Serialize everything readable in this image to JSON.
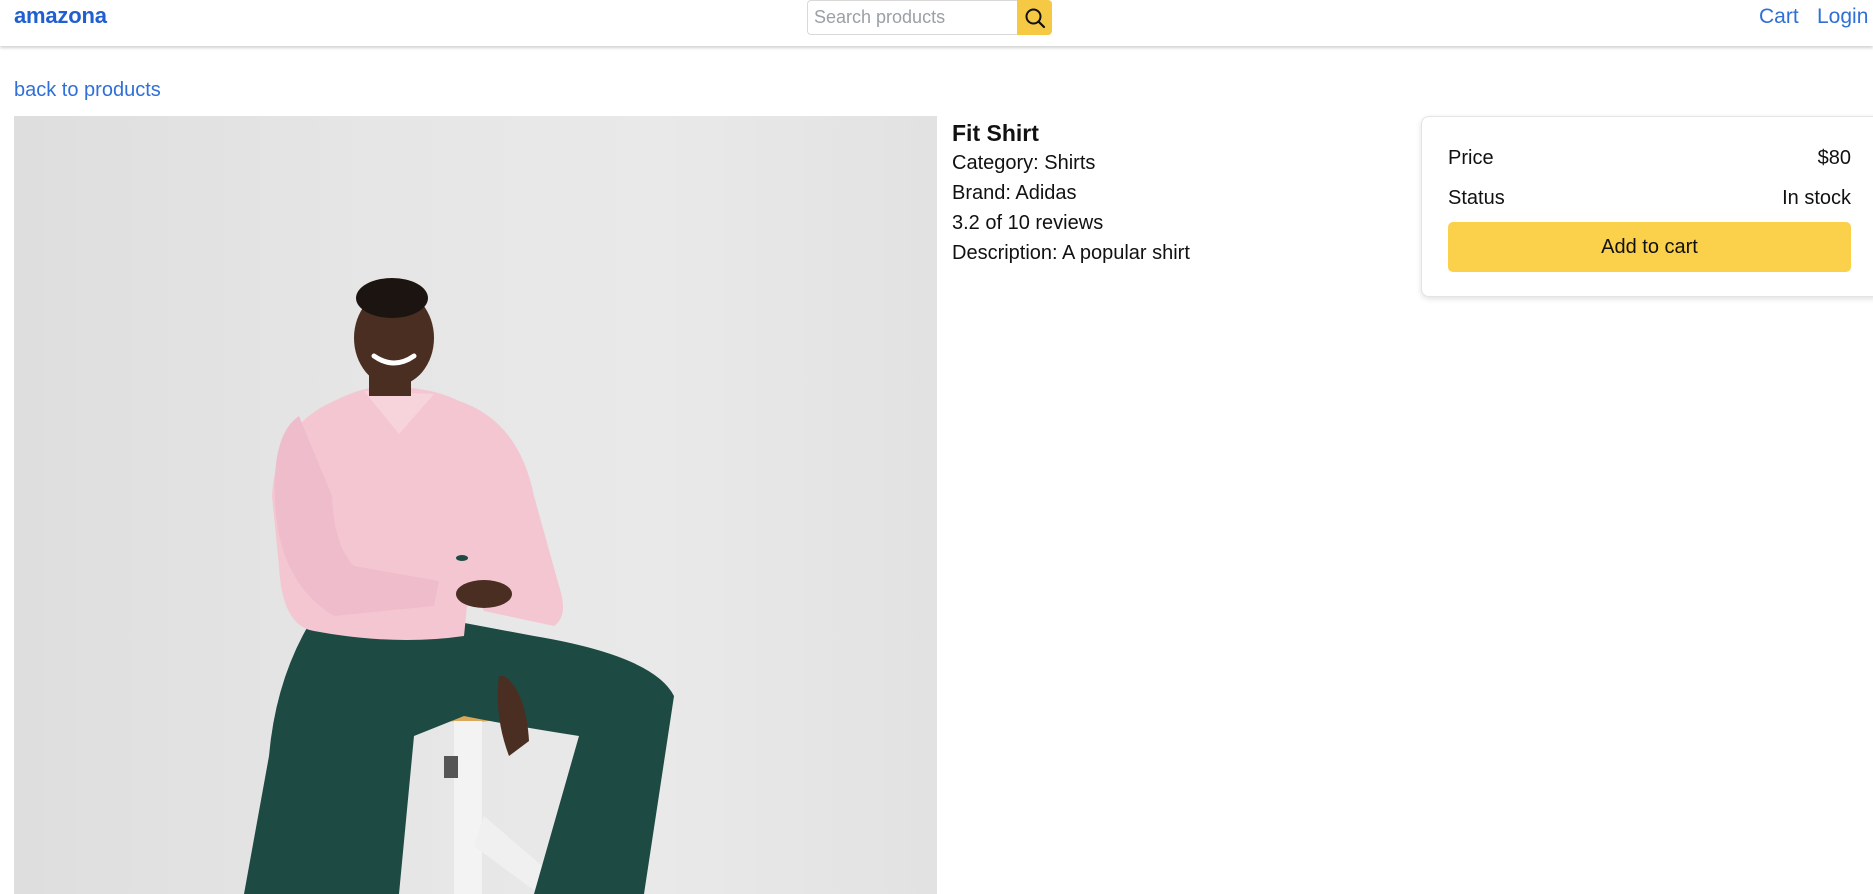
{
  "header": {
    "brand": "amazona",
    "search": {
      "placeholder": "Search products",
      "value": "",
      "button_icon": "search-icon"
    },
    "nav": {
      "cart": "Cart",
      "login": "Login"
    },
    "colors": {
      "brand": "#1f5fd0",
      "link": "#2f6fd8",
      "search_button": "#f6c945"
    }
  },
  "back_link": "back to products",
  "product": {
    "name": "Fit Shirt",
    "category": "Category: Shirts",
    "brand": "Brand: Adidas",
    "reviews": "3.2 of 10 reviews",
    "description": "Description: A popular shirt",
    "image_icon": "product-photo"
  },
  "price_card": {
    "price_label": "Price",
    "price_value": "$80",
    "status_label": "Status",
    "status_value": "In stock",
    "add_to_cart_label": "Add to cart",
    "button_color": "#fbd14b"
  }
}
